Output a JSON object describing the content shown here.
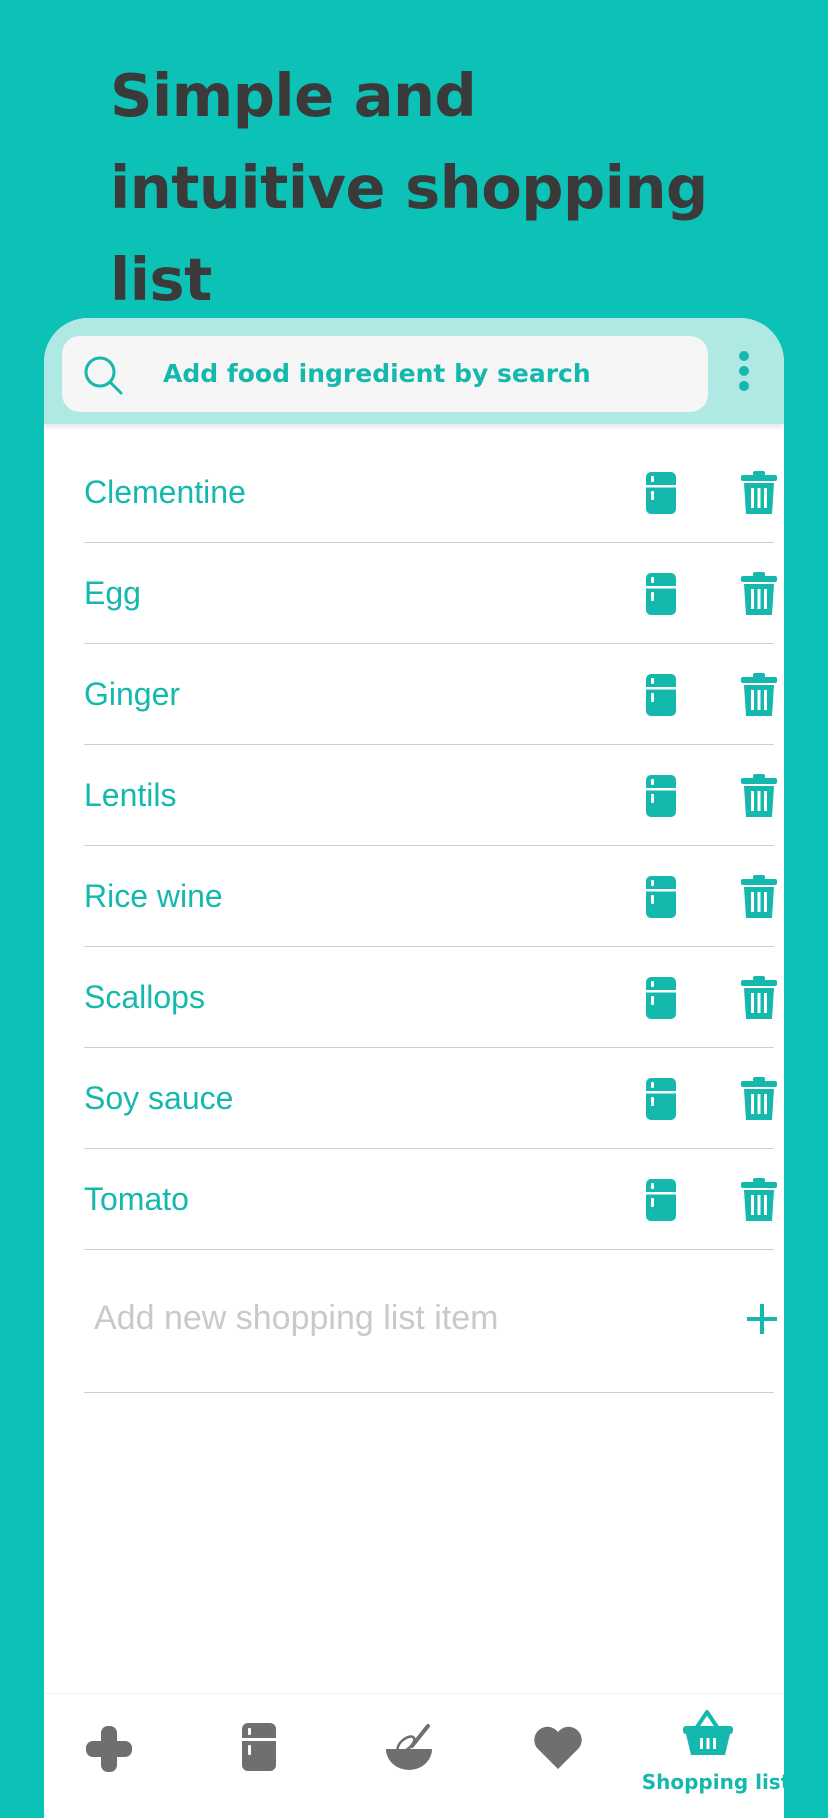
{
  "headline": "Simple and intuitive shopping list",
  "search": {
    "placeholder": "Add food ingredient by search"
  },
  "items": [
    {
      "name": "Clementine"
    },
    {
      "name": "Egg"
    },
    {
      "name": "Ginger"
    },
    {
      "name": "Lentils"
    },
    {
      "name": "Rice wine"
    },
    {
      "name": "Scallops"
    },
    {
      "name": "Soy sauce"
    },
    {
      "name": "Tomato"
    }
  ],
  "add_item": {
    "placeholder": "Add new shopping list item"
  },
  "nav": {
    "items": [
      {
        "icon": "plus-icon"
      },
      {
        "icon": "fridge-icon"
      },
      {
        "icon": "whisk-bowl-icon"
      },
      {
        "icon": "heart-icon"
      },
      {
        "icon": "basket-icon",
        "label": "Shopping list",
        "active": true
      }
    ]
  },
  "colors": {
    "background": "#0cc1b6",
    "accent": "#15b8ad",
    "search_bar": "#b0e8e3",
    "inactive_icon": "#6f6f6f",
    "headline": "#3a3a3a"
  }
}
